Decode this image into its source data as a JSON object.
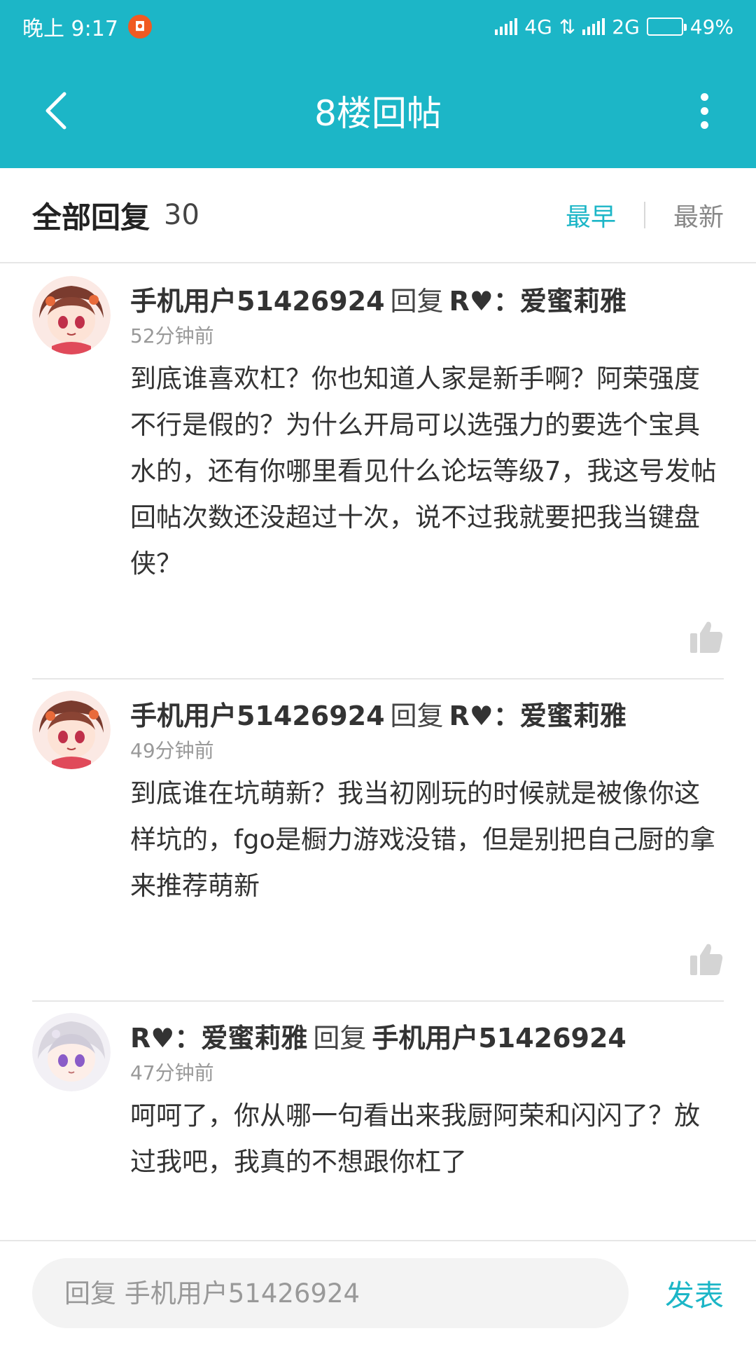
{
  "status_bar": {
    "time": "晚上 9:17",
    "network1": "4G",
    "network2": "2G",
    "battery_percent": "49%",
    "battery_level": 0.49
  },
  "topbar": {
    "title": "8楼回帖"
  },
  "sort": {
    "title": "全部回复",
    "count": "30",
    "earliest": "最早",
    "latest": "最新",
    "active": "最早",
    "accent_color": "#1cb6c7"
  },
  "replies": [
    {
      "user": "手机用户51426924",
      "verb": "回复",
      "target": "R♥：爱蜜莉雅",
      "time": "52分钟前",
      "body": "到底谁喜欢杠？你也知道人家是新手啊？阿荣强度不行是假的？为什么开局可以选强力的要选个宝具水的，还有你哪里看见什么论坛等级7，我这号发帖回帖次数还没超过十次，说不过我就要把我当键盘侠？",
      "avatar": "anime-girl-brown-hair-avatar"
    },
    {
      "user": "手机用户51426924",
      "verb": "回复",
      "target": "R♥：爱蜜莉雅",
      "time": "49分钟前",
      "body": "到底谁在坑萌新？我当初刚玩的时候就是被像你这样坑的，fgo是橱力游戏没错，但是别把自己厨的拿来推荐萌新",
      "avatar": "anime-girl-brown-hair-avatar"
    },
    {
      "user": "R♥：爱蜜莉雅",
      "verb": "回复",
      "target": "手机用户51426924",
      "time": "47分钟前",
      "body": "呵呵了，你从哪一句看出来我厨阿荣和闪闪了？放过我吧，我真的不想跟你杠了",
      "avatar": "anime-girl-silver-hair-avatar"
    }
  ],
  "footer": {
    "placeholder": "回复 手机用户51426924",
    "send_label": "发表"
  }
}
